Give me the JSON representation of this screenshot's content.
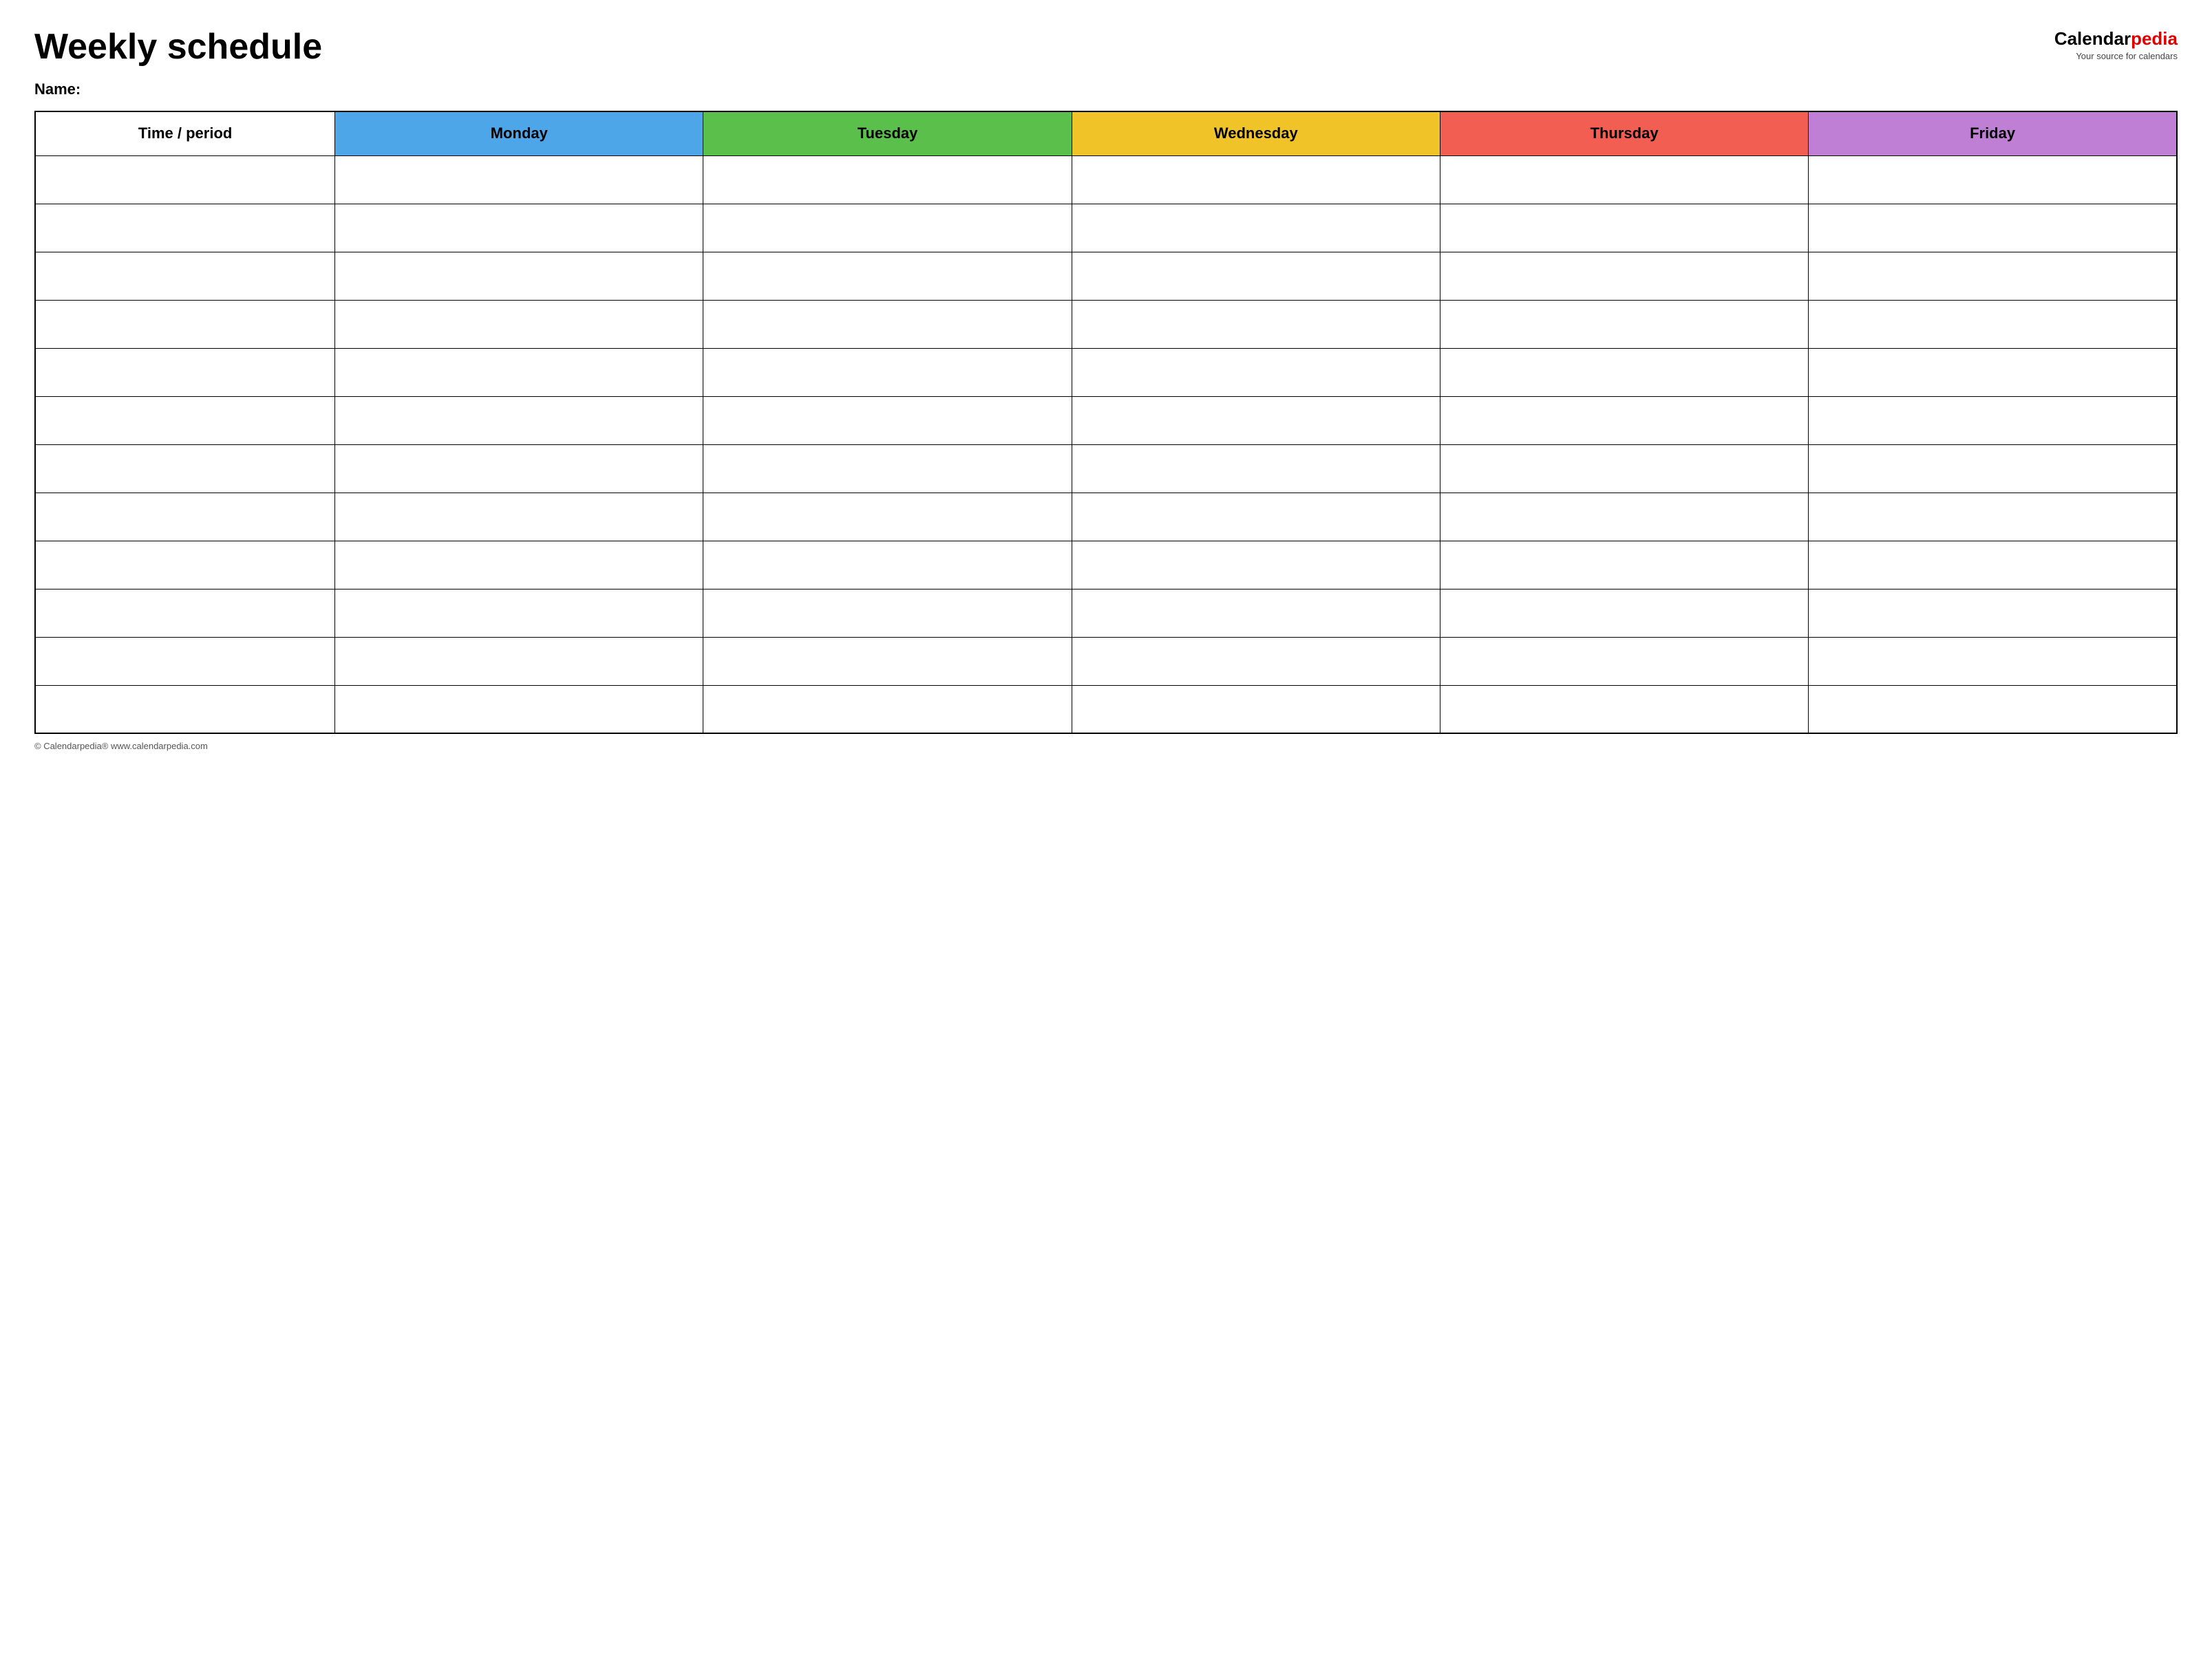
{
  "header": {
    "title": "Weekly schedule",
    "brand": {
      "calendar_part": "Calendar",
      "pedia_part": "pedia",
      "tagline": "Your source for calendars"
    }
  },
  "name_label": "Name:",
  "table": {
    "columns": [
      {
        "key": "time",
        "label": "Time / period",
        "color": "#ffffff"
      },
      {
        "key": "monday",
        "label": "Monday",
        "color": "#4da6e8"
      },
      {
        "key": "tuesday",
        "label": "Tuesday",
        "color": "#5bbf4b"
      },
      {
        "key": "wednesday",
        "label": "Wednesday",
        "color": "#f0c428"
      },
      {
        "key": "thursday",
        "label": "Thursday",
        "color": "#f25f52"
      },
      {
        "key": "friday",
        "label": "Friday",
        "color": "#bf7fd4"
      }
    ],
    "row_count": 12
  },
  "footer": {
    "text": "© Calendarpedia®  www.calendarpedia.com"
  }
}
